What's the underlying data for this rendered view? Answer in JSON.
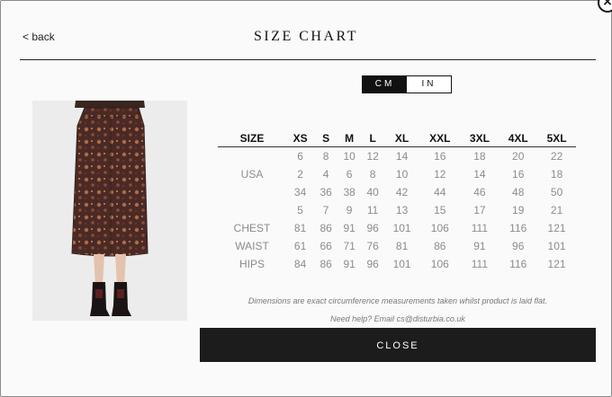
{
  "modal": {
    "close_glyph": "×",
    "back_label": "< back",
    "title": "SIZE CHART"
  },
  "units": {
    "cm": "CM",
    "in": "IN",
    "selected": "CM"
  },
  "table": {
    "headers": [
      "SIZE",
      "XS",
      "S",
      "M",
      "L",
      "XL",
      "XXL",
      "3XL",
      "4XL",
      "5XL"
    ],
    "rows": [
      {
        "label": "",
        "values": [
          "6",
          "8",
          "10",
          "12",
          "14",
          "16",
          "18",
          "20",
          "22"
        ]
      },
      {
        "label": "USA",
        "values": [
          "2",
          "4",
          "6",
          "8",
          "10",
          "12",
          "14",
          "16",
          "18"
        ]
      },
      {
        "label": "",
        "values": [
          "34",
          "36",
          "38",
          "40",
          "42",
          "44",
          "46",
          "48",
          "50"
        ]
      },
      {
        "label": "",
        "values": [
          "5",
          "7",
          "9",
          "11",
          "13",
          "15",
          "17",
          "19",
          "21"
        ]
      },
      {
        "label": "CHEST",
        "values": [
          "81",
          "86",
          "91",
          "96",
          "101",
          "106",
          "111",
          "116",
          "121"
        ]
      },
      {
        "label": "WAIST",
        "values": [
          "61",
          "66",
          "71",
          "76",
          "81",
          "86",
          "91",
          "96",
          "101"
        ]
      },
      {
        "label": "HIPS",
        "values": [
          "84",
          "86",
          "91",
          "96",
          "101",
          "106",
          "111",
          "116",
          "121"
        ]
      }
    ]
  },
  "notes": {
    "dimensions": "Dimensions are exact circumference measurements taken whilst product is laid flat.",
    "help": "Need help? Email cs@disturbia.co.uk"
  },
  "close_button_label": "CLOSE",
  "colors": {
    "accent": "#1c1c1c",
    "skirt": "#4a2a26",
    "pattern": "#b06a44"
  }
}
